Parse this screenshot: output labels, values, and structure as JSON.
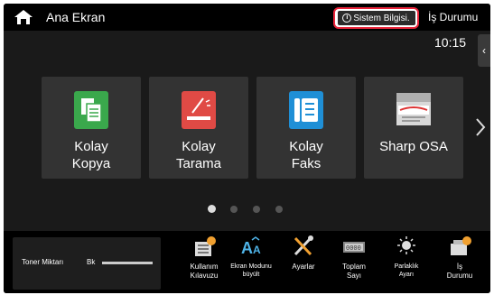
{
  "header": {
    "home_title": "Ana Ekran",
    "system_info_label": "Sistem Bilgisi.",
    "job_status_label": "İş Durumu"
  },
  "clock": "10:15",
  "side_tab_glyph": "‹",
  "tiles": [
    {
      "label": "Kolay\nKopya",
      "icon": "copy-icon",
      "color": "#3aa84c"
    },
    {
      "label": "Kolay\nTarama",
      "icon": "scan-icon",
      "color": "#e04a45"
    },
    {
      "label": "Kolay\nFaks",
      "icon": "fax-icon",
      "color": "#1f8fd6"
    },
    {
      "label": "Sharp OSA",
      "icon": "osa-icon",
      "color": "#d8d8d8"
    }
  ],
  "pager": {
    "total": 4,
    "active": 0
  },
  "toner": {
    "label": "Toner Miktarı",
    "channel": "Bk"
  },
  "bottom_buttons": [
    {
      "label": "Kullanım\nKılavuzu",
      "icon": "manual-icon"
    },
    {
      "label": "Ekran Modunu\nbüyült",
      "icon": "font-size-icon"
    },
    {
      "label": "Ayarlar",
      "icon": "settings-tools-icon"
    },
    {
      "label": "Toplam\nSayı",
      "icon": "counter-icon"
    },
    {
      "label": "Parlaklık\nAyarı",
      "icon": "brightness-icon"
    },
    {
      "label": "İş\nDurumu",
      "icon": "job-status-icon"
    }
  ],
  "colors": {
    "highlight": "#e8243a",
    "background": "#1a1a1a",
    "tile_bg": "#333333"
  }
}
